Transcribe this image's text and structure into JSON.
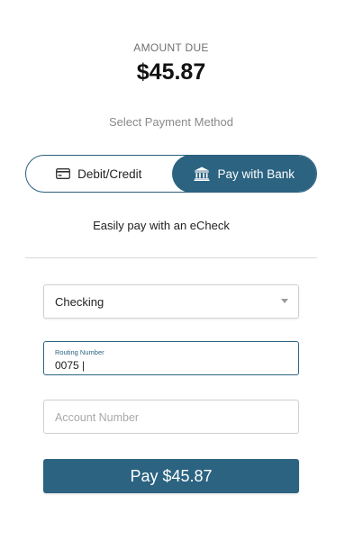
{
  "amount": {
    "label": "AMOUNT DUE",
    "value": "$45.87"
  },
  "payment_method": {
    "heading": "Select Payment Method",
    "options": [
      {
        "label": "Debit/Credit",
        "icon": "credit-card-icon",
        "selected": false
      },
      {
        "label": "Pay with Bank",
        "icon": "bank-icon",
        "selected": true
      }
    ]
  },
  "echeck_text": "Easily pay with an eCheck",
  "form": {
    "account_type": {
      "value": "Checking"
    },
    "routing_number": {
      "label": "Routing Number",
      "value": "0075 |"
    },
    "account_number": {
      "placeholder": "Account Number"
    }
  },
  "pay_button": {
    "label": "Pay $45.87"
  },
  "colors": {
    "accent": "#2b6381",
    "text": "#222222",
    "muted": "#8a8a8a",
    "border": "#cfcfcf"
  }
}
